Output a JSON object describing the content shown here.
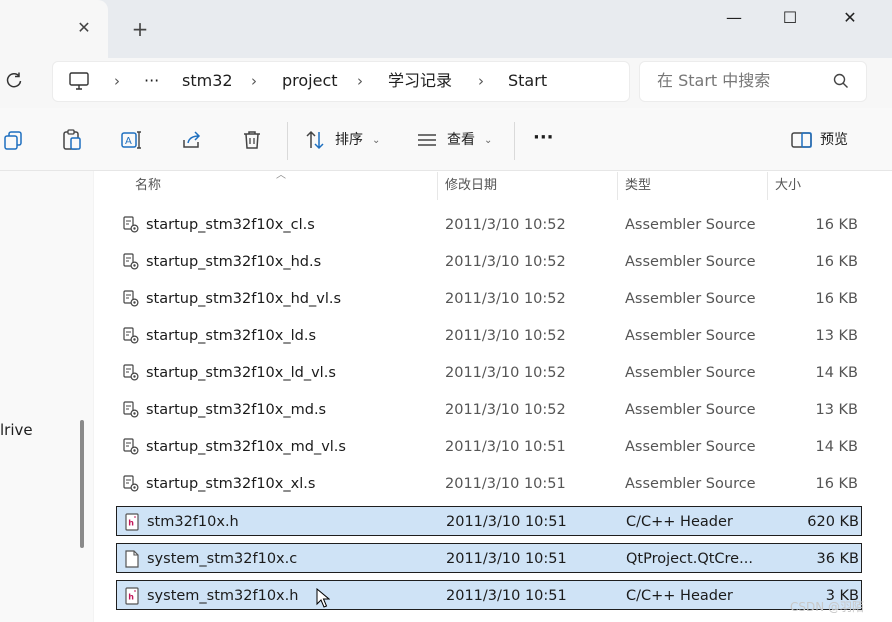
{
  "window": {
    "tab_close": "✕",
    "new_tab": "+",
    "minimize": "—",
    "maximize": "☐",
    "close": "✕"
  },
  "address": {
    "more": "···",
    "crumbs": [
      "stm32",
      "project",
      "学习记录",
      "Start"
    ],
    "sep": "›"
  },
  "search": {
    "placeholder": "在 Start 中搜索"
  },
  "toolbar": {
    "sort_label": "排序",
    "view_label": "查看",
    "more": "···",
    "preview_label": "预览"
  },
  "nav": {
    "partial_label": "lrive"
  },
  "columns": {
    "name": "名称",
    "date": "修改日期",
    "type": "类型",
    "size": "大小"
  },
  "files": [
    {
      "name": "startup_stm32f10x_cl.s",
      "date": "2011/3/10 10:52",
      "type": "Assembler Source",
      "size": "16 KB",
      "icon": "assembler-file-icon",
      "selected": false
    },
    {
      "name": "startup_stm32f10x_hd.s",
      "date": "2011/3/10 10:52",
      "type": "Assembler Source",
      "size": "16 KB",
      "icon": "assembler-file-icon",
      "selected": false
    },
    {
      "name": "startup_stm32f10x_hd_vl.s",
      "date": "2011/3/10 10:52",
      "type": "Assembler Source",
      "size": "16 KB",
      "icon": "assembler-file-icon",
      "selected": false
    },
    {
      "name": "startup_stm32f10x_ld.s",
      "date": "2011/3/10 10:52",
      "type": "Assembler Source",
      "size": "13 KB",
      "icon": "assembler-file-icon",
      "selected": false
    },
    {
      "name": "startup_stm32f10x_ld_vl.s",
      "date": "2011/3/10 10:52",
      "type": "Assembler Source",
      "size": "14 KB",
      "icon": "assembler-file-icon",
      "selected": false
    },
    {
      "name": "startup_stm32f10x_md.s",
      "date": "2011/3/10 10:52",
      "type": "Assembler Source",
      "size": "13 KB",
      "icon": "assembler-file-icon",
      "selected": false
    },
    {
      "name": "startup_stm32f10x_md_vl.s",
      "date": "2011/3/10 10:51",
      "type": "Assembler Source",
      "size": "14 KB",
      "icon": "assembler-file-icon",
      "selected": false
    },
    {
      "name": "startup_stm32f10x_xl.s",
      "date": "2011/3/10 10:51",
      "type": "Assembler Source",
      "size": "16 KB",
      "icon": "assembler-file-icon",
      "selected": false
    },
    {
      "name": "stm32f10x.h",
      "date": "2011/3/10 10:51",
      "type": "C/C++ Header",
      "size": "620 KB",
      "icon": "header-file-icon",
      "selected": true
    },
    {
      "name": "system_stm32f10x.c",
      "date": "2011/3/10 10:51",
      "type": "QtProject.QtCre...",
      "size": "36 KB",
      "icon": "c-file-icon",
      "selected": true
    },
    {
      "name": "system_stm32f10x.h",
      "date": "2011/3/10 10:51",
      "type": "C/C++ Header",
      "size": "3 KB",
      "icon": "header-file-icon",
      "selected": true
    }
  ],
  "watermark": "CSDN @羽陌",
  "colors": {
    "selection": "#cfe3f6",
    "header_icon_accent": "#c2185b"
  }
}
